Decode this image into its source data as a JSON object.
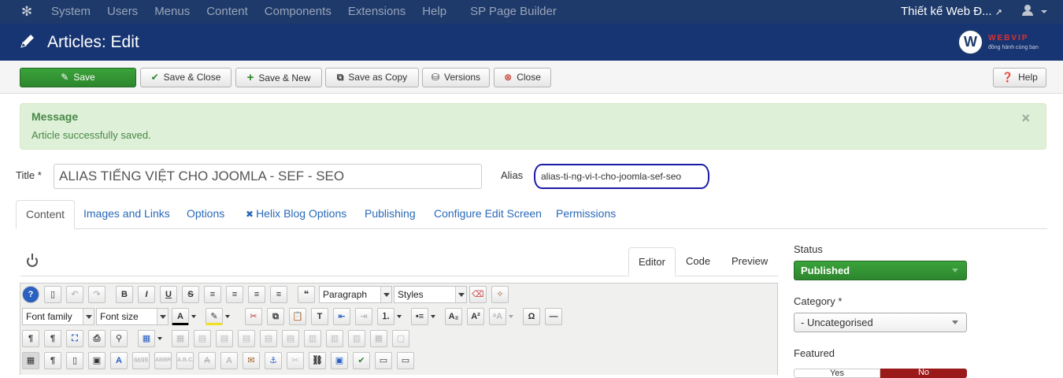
{
  "topnav": {
    "menu": [
      "System",
      "Users",
      "Menus",
      "Content",
      "Components",
      "Extensions",
      "Help",
      "SP Page Builder"
    ],
    "site_link": "Thiết kế Web Đ..."
  },
  "header": {
    "title": "Articles: Edit",
    "logo_name": "WEBVIP",
    "logo_tagline": "đồng hành cùng bạn",
    "logo_glyph": "W"
  },
  "toolbar": {
    "save": "Save",
    "save_close": "Save & Close",
    "save_new": "Save & New",
    "save_copy": "Save as Copy",
    "versions": "Versions",
    "close": "Close",
    "help": "Help"
  },
  "message": {
    "heading": "Message",
    "text": "Article successfully saved.",
    "close_glyph": "×"
  },
  "form": {
    "title_label": "Title *",
    "title_value": "ALIAS TIẾNG VIỆT CHO JOOMLA - SEF - SEO",
    "alias_label": "Alias",
    "alias_value": "alias-ti-ng-vi-t-cho-joomla-sef-seo"
  },
  "tabs": [
    "Content",
    "Images and Links",
    "Options",
    "Helix Blog Options",
    "Publishing",
    "Configure Edit Screen",
    "Permissions"
  ],
  "editor": {
    "tabs": [
      "Editor",
      "Code",
      "Preview"
    ],
    "format_select": "Paragraph",
    "styles_select": "Styles",
    "font_family_select": "Font family",
    "font_size_select": "Font size"
  },
  "sidebar": {
    "status_label": "Status",
    "status_value": "Published",
    "category_label": "Category *",
    "category_value": "- Uncategorised",
    "featured_label": "Featured",
    "featured_yes": "Yes",
    "featured_no": "No"
  },
  "colors": {
    "topnav_bg": "#1d3a6b",
    "header_bg": "#173572",
    "save_green": "#2d862d",
    "alert_bg": "#dff0d8",
    "alias_highlight": "#1a1aa6",
    "featured_no": "#9a1a1a"
  }
}
